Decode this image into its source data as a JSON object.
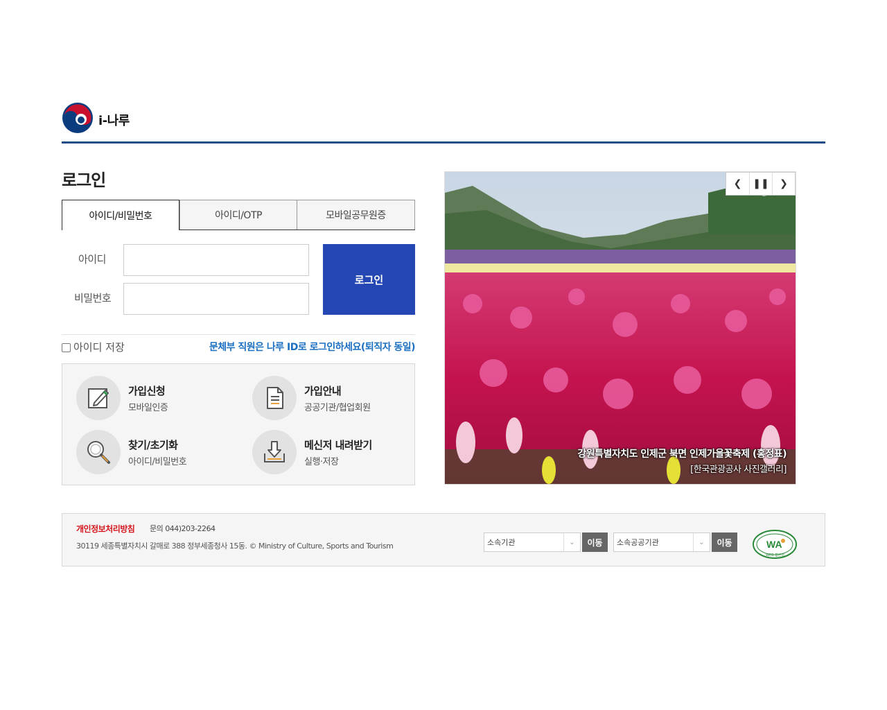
{
  "header": {
    "logo_text": "i-나루"
  },
  "login": {
    "title": "로그인",
    "tabs": [
      {
        "label": "아이디/비밀번호",
        "active": true
      },
      {
        "label": "아이디/OTP",
        "active": false
      },
      {
        "label": "모바일공무원증",
        "active": false
      }
    ],
    "id_label": "아이디",
    "pw_label": "비밀번호",
    "id_value": "",
    "pw_value": "",
    "submit_label": "로그인",
    "save_id_label": "아이디 저장",
    "save_id_checked": false,
    "notice_link": "문체부 직원은 나루 ID로 로그인하세요(퇴직자 동일)"
  },
  "menu": [
    {
      "title": "가입신청",
      "sub": "모바일인증",
      "icon": "pencil-icon"
    },
    {
      "title": "가입안내",
      "sub": "공공기관/협업회원",
      "icon": "document-icon"
    },
    {
      "title": "찾기/초기화",
      "sub": "아이디/비밀번호",
      "icon": "magnifier-icon"
    },
    {
      "title": "메신저 내려받기",
      "sub": "실행·저장",
      "icon": "download-icon"
    }
  ],
  "slider": {
    "caption": "강원특별자치도 인제군 북면 인제가을꽃축제 (홍정표)",
    "credit": "[한국관광공사 사진갤러리]",
    "prev_icon": "chevron-left-icon",
    "pause_icon": "pause-icon",
    "next_icon": "chevron-right-icon"
  },
  "footer": {
    "policy_label": "개인정보처리방침",
    "contact": "문의 044)203-2264",
    "address": "30119 세종특별자치시 갈매로 388 정부세종청사 15동. © Ministry of Culture, Sports and Tourism",
    "select1": "소속기관",
    "select2": "소속공공기관",
    "go_label": "이동",
    "wa_text": "WA",
    "wa_sub": "WEB 접근성"
  },
  "colors": {
    "header_line": "#1b4f85",
    "login_button": "#2447b3",
    "notice_link": "#1b6fc0",
    "policy": "#d6161d",
    "go_button": "#666666"
  }
}
